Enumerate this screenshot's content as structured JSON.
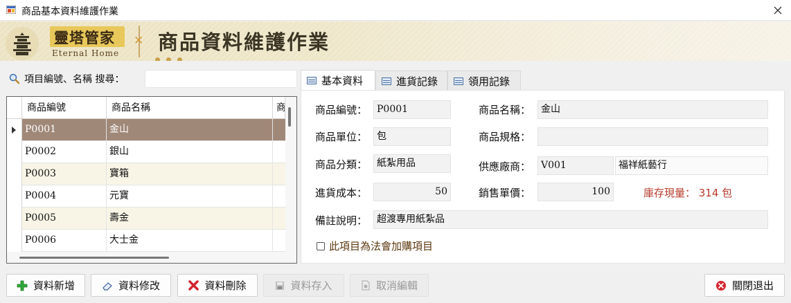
{
  "window": {
    "title": "商品基本資料維護作業"
  },
  "banner": {
    "logo_text": "靈塔管家",
    "logo_sub": "Eternal Home",
    "heading": "商品資料維護作業"
  },
  "search": {
    "label": "項目編號、名稱 搜尋：",
    "value": ""
  },
  "grid": {
    "columns": [
      "商品編號",
      "商品名稱",
      "商"
    ],
    "rows": [
      {
        "code": "P0001",
        "name": "金山"
      },
      {
        "code": "P0002",
        "name": "銀山"
      },
      {
        "code": "P0003",
        "name": "寶箱"
      },
      {
        "code": "P0004",
        "name": "元寶"
      },
      {
        "code": "P0005",
        "name": "壽金"
      },
      {
        "code": "P0006",
        "name": "大士金"
      }
    ],
    "current_row": 0
  },
  "tabs": [
    {
      "label": "基本資料",
      "active": true
    },
    {
      "label": "進貨記錄",
      "active": false
    },
    {
      "label": "領用記錄",
      "active": false
    }
  ],
  "form": {
    "code_label": "商品編號：",
    "code_value": "P0001",
    "name_label": "商品名稱：",
    "name_value": "金山",
    "unit_label": "商品單位：",
    "unit_value": "包",
    "spec_label": "商品規格：",
    "spec_value": "",
    "category_label": "商品分類：",
    "category_value": "紙紮用品",
    "supplier_label": "供應廠商：",
    "supplier_code": "V001",
    "supplier_name": "福祥紙藝行",
    "cost_label": "進貨成本：",
    "cost_value": "50",
    "price_label": "銷售單價：",
    "price_value": "100",
    "stock_text": "庫存現量： 314 包",
    "remark_label": "備註說明：",
    "remark_value": "超渡專用紙紮品",
    "checkbox_label": "此項目為法會加購項目",
    "checkbox_checked": false
  },
  "buttons": {
    "add": "資料新增",
    "edit": "資料修改",
    "delete": "資料刪除",
    "save": "資料存入",
    "cancel": "取消編輯",
    "close": "關閉退出"
  },
  "colors": {
    "selected_row": "#a08878",
    "alt_row": "#f8f5e7",
    "stock_text": "#b63a2a",
    "banner_bg": "#ece3c3"
  }
}
